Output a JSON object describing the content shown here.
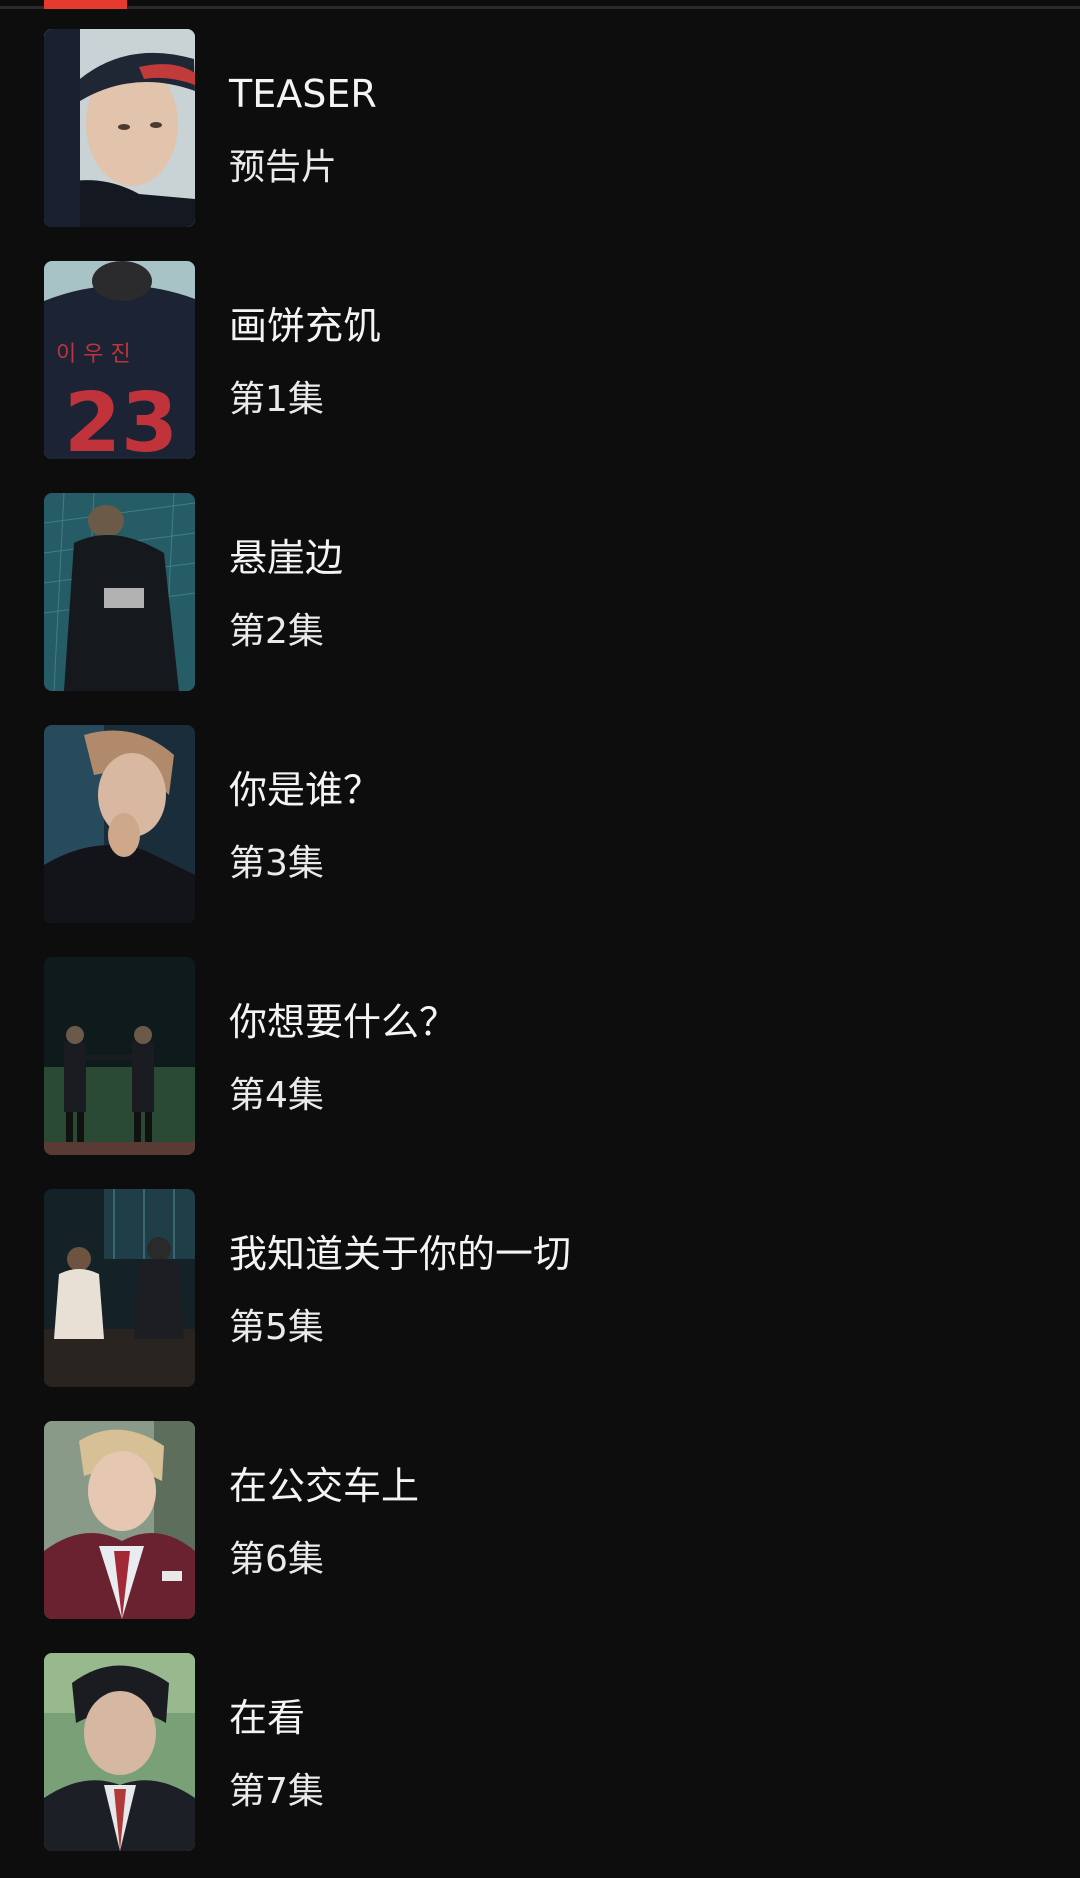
{
  "tabs": {
    "active_color": "#e63a2e"
  },
  "episodes": [
    {
      "title": "TEASER",
      "subtitle": "预告片",
      "thumbnail": "player-baseball-cap-closeup"
    },
    {
      "title": "画饼充饥",
      "subtitle": "第1集",
      "thumbnail": "jersey-back-number-23"
    },
    {
      "title": "悬崖边",
      "subtitle": "第2集",
      "thumbnail": "student-by-batting-net"
    },
    {
      "title": "你是谁？",
      "subtitle": "第3集",
      "thumbnail": "student-hand-on-chin"
    },
    {
      "title": "你想要什么？",
      "subtitle": "第4集",
      "thumbnail": "two-students-on-field-at-night"
    },
    {
      "title": "我知道关于你的一切",
      "subtitle": "第5集",
      "thumbnail": "students-sitting-on-bleachers"
    },
    {
      "title": "在公交车上",
      "subtitle": "第6集",
      "thumbnail": "student-with-red-hoodie"
    },
    {
      "title": "在看",
      "subtitle": "第7集",
      "thumbnail": "student-in-school-uniform"
    }
  ]
}
